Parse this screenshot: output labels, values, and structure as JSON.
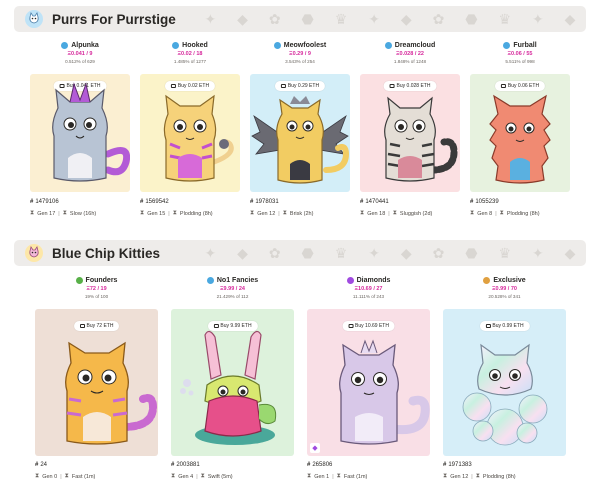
{
  "sections": [
    {
      "title": "Purrs For Purrstige",
      "columns": [
        {
          "name": "Alpunka",
          "price": "Ξ0.041 / 9",
          "pct": "0.512% of 629",
          "buy": "Buy 0.041 ETH",
          "id": "1479106",
          "gen": "Gen 17",
          "speed": "Slow (16h)",
          "bg": "#fbefd2",
          "dot": "#4aa8e0"
        },
        {
          "name": "Hooked",
          "price": "Ξ0.02 / 18",
          "pct": "1.485% of 1277",
          "buy": "Buy 0.02 ETH",
          "id": "1569542",
          "gen": "Gen 15",
          "speed": "Plodding (8h)",
          "bg": "#fbf3c9",
          "dot": "#4aa8e0"
        },
        {
          "name": "Meowfoolest",
          "price": "Ξ0.29 / 9",
          "pct": "3.543% of 254",
          "buy": "Buy 0.29 ETH",
          "id": "1978031",
          "gen": "Gen 12",
          "speed": "Brisk (2h)",
          "bg": "#d3eef8",
          "dot": "#4aa8e0"
        },
        {
          "name": "Dreamcloud",
          "price": "Ξ0.028 / 22",
          "pct": "1.848% of 1248",
          "buy": "Buy 0.028 ETH",
          "id": "1470441",
          "gen": "Gen 18",
          "speed": "Sluggish (2d)",
          "bg": "#fbe0e2",
          "dot": "#4aa8e0"
        },
        {
          "name": "Furball",
          "price": "Ξ0.06 / 55",
          "pct": "5.511% of 998",
          "buy": "Buy 0.06 ETH",
          "id": "1055239",
          "gen": "Gen 8",
          "speed": "Plodding (8h)",
          "bg": "#e7f2df",
          "dot": "#4aa8e0"
        }
      ]
    },
    {
      "title": "Blue Chip Kitties",
      "columns": [
        {
          "name": "Founders",
          "price": "Ξ72 / 19",
          "pct": "19% of 100",
          "buy": "Buy 72 ETH",
          "id": "24",
          "gen": "Gen 0",
          "speed": "Fast (1m)",
          "bg": "#eedfd6",
          "dot": "#58b048"
        },
        {
          "name": "No1 Fancies",
          "price": "Ξ9.99 / 24",
          "pct": "21.429% of 112",
          "buy": "Buy 9.99 ETH",
          "id": "2003881",
          "gen": "Gen 4",
          "speed": "Swift (5m)",
          "bg": "#ddf2dc",
          "dot": "#4aa8e0"
        },
        {
          "name": "Diamonds",
          "price": "Ξ10.69 / 27",
          "pct": "11.111% of 243",
          "buy": "Buy 10.69 ETH",
          "id": "265806",
          "gen": "Gen 1",
          "speed": "Fast (1m)",
          "bg": "#f9dfe6",
          "dot": "#a04be0"
        },
        {
          "name": "Exclusive",
          "price": "Ξ0.99 / 70",
          "pct": "20.528% of 341",
          "buy": "Buy 0.99 ETH",
          "id": "1971383",
          "gen": "Gen 12",
          "speed": "Plodding (8h)",
          "bg": "#d6eef8",
          "dot": "#e0a040"
        }
      ]
    }
  ],
  "icons": {
    "tag": "price-tag-icon",
    "hash": "#",
    "hourglass": "hourglass-icon",
    "diamond_badge": "diamond-badge-icon"
  }
}
